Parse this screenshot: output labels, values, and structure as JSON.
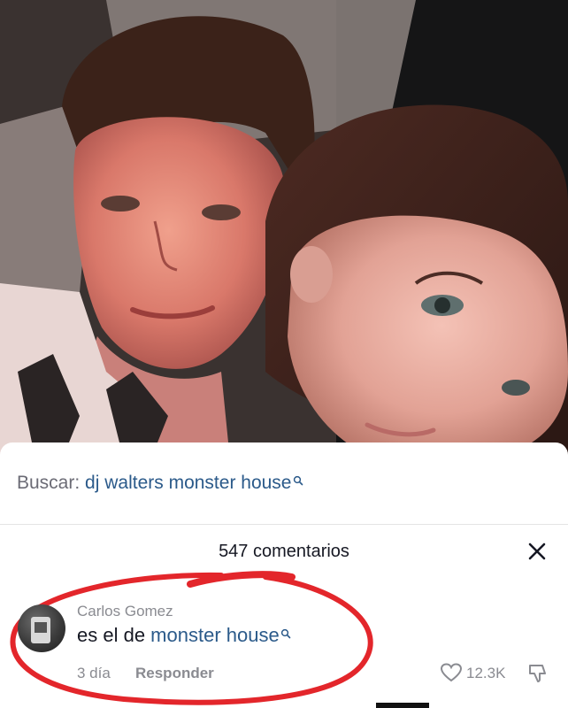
{
  "search": {
    "prefix": "Buscar:",
    "query": "dj walters monster house"
  },
  "comments": {
    "count_label": "547 comentarios"
  },
  "comment": {
    "author": "Carlos Gomez",
    "text_prefix": "es el de ",
    "text_link": "monster house",
    "time": "3 día",
    "reply_label": "Responder",
    "likes": "12.3K"
  },
  "icons": {
    "close": "close-icon",
    "search": "search-icon",
    "like": "heart-icon",
    "dislike": "dislike-icon"
  },
  "colors": {
    "link": "#2b5a8a",
    "annotation": "#e3262b"
  }
}
